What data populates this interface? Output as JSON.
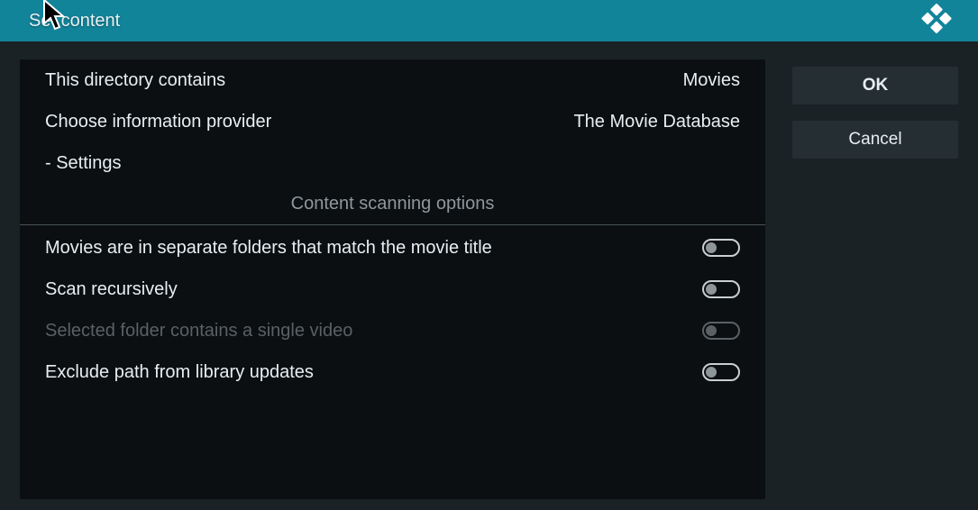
{
  "header": {
    "title": "Set content"
  },
  "rows": {
    "contains": {
      "label": "This directory contains",
      "value": "Movies"
    },
    "provider": {
      "label": "Choose information provider",
      "value": "The Movie Database"
    },
    "settings": {
      "label": "- Settings"
    }
  },
  "section": {
    "title": "Content scanning options"
  },
  "options": {
    "separate": {
      "label": "Movies are in separate folders that match the movie title",
      "on": false,
      "disabled": false
    },
    "recursive": {
      "label": "Scan recursively",
      "on": false,
      "disabled": false
    },
    "singlevid": {
      "label": "Selected folder contains a single video",
      "on": false,
      "disabled": true
    },
    "exclude": {
      "label": "Exclude path from library updates",
      "on": false,
      "disabled": false
    }
  },
  "buttons": {
    "ok": "OK",
    "cancel": "Cancel"
  },
  "colors": {
    "accent": "#12849a"
  }
}
